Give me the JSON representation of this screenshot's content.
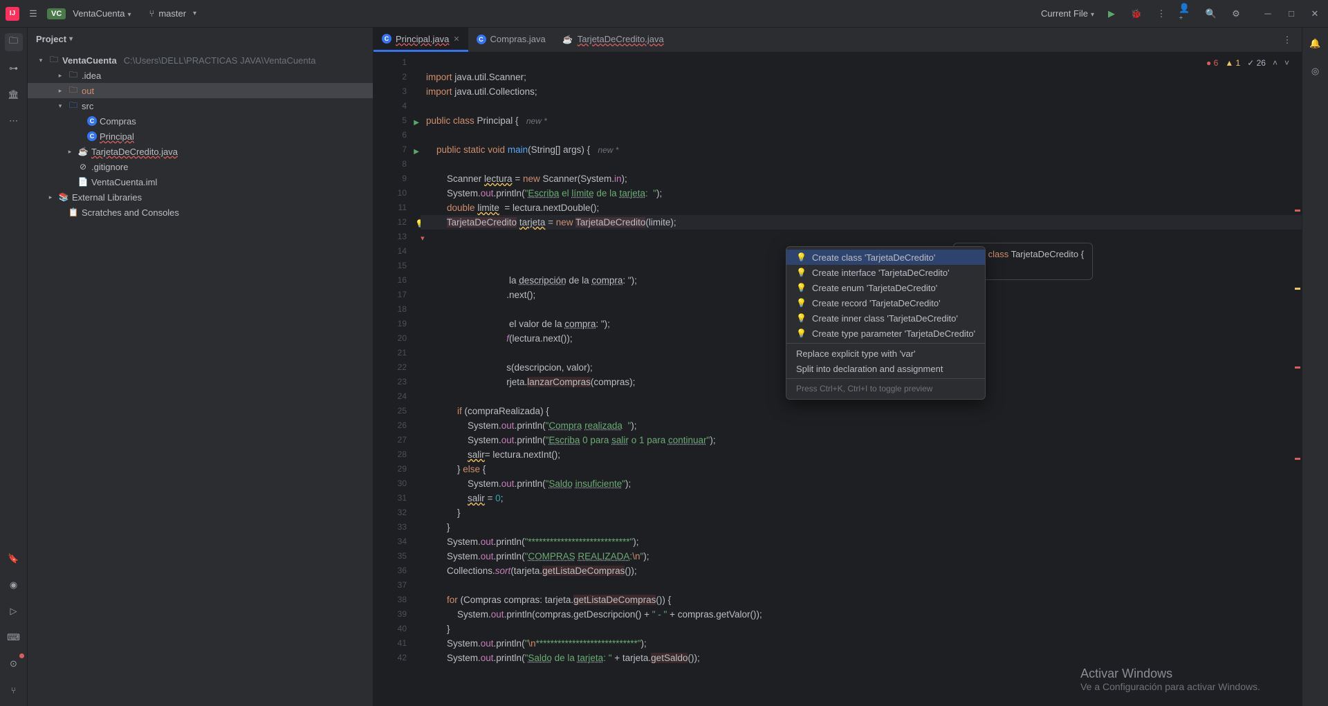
{
  "titlebar": {
    "project_badge": "VC",
    "project_name": "VentaCuenta",
    "branch": "master",
    "run_config": "Current File"
  },
  "project_panel": {
    "header": "Project",
    "root": "VentaCuenta",
    "root_path": "C:\\Users\\DELL\\PRACTICAS JAVA\\VentaCuenta",
    "items": [
      ".idea",
      "out",
      "src",
      "Compras",
      "Principal",
      "TarjetaDeCredito.java",
      ".gitignore",
      "VentaCuenta.iml",
      "External Libraries",
      "Scratches and Consoles"
    ]
  },
  "tabs": [
    {
      "label": "Principal.java",
      "active": true,
      "error": true
    },
    {
      "label": "Compras.java",
      "active": false,
      "error": false
    },
    {
      "label": "TarjetaDeCredito.java",
      "active": false,
      "error": true
    }
  ],
  "inspections": {
    "errors": "6",
    "warnings": "1",
    "weak": "26"
  },
  "popup": {
    "items": [
      "Create class 'TarjetaDeCredito'",
      "Create interface 'TarjetaDeCredito'",
      "Create enum 'TarjetaDeCredito'",
      "Create record 'TarjetaDeCredito'",
      "Create inner class 'TarjetaDeCredito'",
      "Create type parameter 'TarjetaDeCredito'"
    ],
    "plain_items": [
      "Replace explicit type with 'var'",
      "Split into declaration and assignment"
    ],
    "hint": "Press Ctrl+K, Ctrl+I to toggle preview"
  },
  "preview": {
    "line1": "public class TarjetaDeCredito {",
    "line2": "}"
  },
  "code": {
    "lines": [
      {
        "n": 1,
        "html": ""
      },
      {
        "n": 2,
        "html": "<span class='kw'>import</span> java.util.Scanner;"
      },
      {
        "n": 3,
        "html": "<span class='kw'>import</span> java.util.Collections;"
      },
      {
        "n": 4,
        "html": ""
      },
      {
        "n": 5,
        "run": true,
        "html": "<span class='kw'>public class</span> Principal {   <span class='hint'>new *</span>"
      },
      {
        "n": 6,
        "html": ""
      },
      {
        "n": 7,
        "run": true,
        "html": "    <span class='kw'>public static void</span> <span class='fn'>main</span>(String[] args) {   <span class='hint'>new *</span>"
      },
      {
        "n": 8,
        "html": ""
      },
      {
        "n": 9,
        "html": "        Scanner <span class='warn-underline'>lectura</span> = <span class='kw'>new</span> Scanner(System.<span class='field'>in</span>);"
      },
      {
        "n": 10,
        "html": "        System.<span class='field'>out</span>.println(<span class='str'>\"<span class='typo'>Escriba</span> el <span class='typo'>límite</span> de la <span class='typo'>tarjeta</span>:  \"</span>);"
      },
      {
        "n": 11,
        "html": "        <span class='kw'>double</span> <span class='warn-underline'>limite</span>  = lectura.nextDouble();"
      },
      {
        "n": 12,
        "err": true,
        "current": true,
        "html": "        <span class='err-underline'>TarjetaDeCredito</span> <span class='warn-underline'>tarjeta</span> = <span class='kw'>new</span> <span class='err-underline'>TarjetaDeCredito</span>(limite);"
      },
      {
        "n": 13,
        "html": ""
      },
      {
        "n": 14,
        "html": ""
      },
      {
        "n": 15,
        "html": ""
      },
      {
        "n": 16,
        "html": "                                la <span class='typo'>descripción</span> de la <span class='typo'>compra</span>: \"</span>);"
      },
      {
        "n": 17,
        "html": "                               .next();"
      },
      {
        "n": 18,
        "html": ""
      },
      {
        "n": 19,
        "html": "                                el valor de la <span class='typo'>compra</span>: \"</span>);"
      },
      {
        "n": 20,
        "html": "                               <span class='fn2'>f</span>(lectura.next());"
      },
      {
        "n": 21,
        "html": ""
      },
      {
        "n": 22,
        "html": "                               s(descripcion, valor);"
      },
      {
        "n": 23,
        "html": "                               rjeta.<span class='err-underline'>lanzarCompras</span>(compras);"
      },
      {
        "n": 24,
        "html": ""
      },
      {
        "n": 25,
        "html": "            <span class='kw'>if</span> (compraRealizada) {"
      },
      {
        "n": 26,
        "html": "                System.<span class='field'>out</span>.println(<span class='str'>\"<span class='typo'>Compra</span> <span class='typo'>realizada</span>  \"</span>);"
      },
      {
        "n": 27,
        "html": "                System.<span class='field'>out</span>.println(<span class='str'>\"<span class='typo'>Escriba</span> 0 para <span class='typo'>salir</span> o 1 para <span class='typo'>continuar</span>\"</span>);"
      },
      {
        "n": 28,
        "html": "                <span class='warn-underline'>salir</span>= lectura.nextInt();"
      },
      {
        "n": 29,
        "html": "            } <span class='kw'>else</span> {"
      },
      {
        "n": 30,
        "html": "                System.<span class='field'>out</span>.println(<span class='str'>\"<span class='typo'>Saldo</span> <span class='typo'>insuficiente</span>\"</span>);"
      },
      {
        "n": 31,
        "html": "                <span class='warn-underline'>salir</span> = <span class='num'>0</span>;"
      },
      {
        "n": 32,
        "html": "            }"
      },
      {
        "n": 33,
        "html": "        }"
      },
      {
        "n": 34,
        "html": "        System.<span class='field'>out</span>.println(<span class='str'>\"****************************\"</span>);"
      },
      {
        "n": 35,
        "html": "        System.<span class='field'>out</span>.println(<span class='str'>\"<span class='typo'>COMPRAS</span> <span class='typo'>REALIZADA</span>:<span class='kw'>\\n</span>\"</span>);"
      },
      {
        "n": 36,
        "html": "        Collections.<span class='fn2'>sort</span>(tarjeta.<span class='err-underline'>getListaDeCompras</span>());"
      },
      {
        "n": 37,
        "html": ""
      },
      {
        "n": 38,
        "html": "        <span class='kw'>for</span> (Compras compras: tarjeta.<span class='err-underline'>getListaDeCompras</span>()) {"
      },
      {
        "n": 39,
        "html": "            System.<span class='field'>out</span>.println(compras.getDescripcion() + <span class='str'>\" - \"</span> + compras.getValor());"
      },
      {
        "n": 40,
        "html": "        }"
      },
      {
        "n": 41,
        "html": "        System.<span class='field'>out</span>.println(<span class='str'>\"<span class='kw'>\\n</span>****************************\"</span>);"
      },
      {
        "n": 42,
        "html": "        System.<span class='field'>out</span>.println(<span class='str'>\"<span class='typo'>Saldo</span> de la <span class='typo'>tarjeta</span>: \"</span> + tarjeta.<span class='err-underline'>getSaldo</span>());"
      }
    ]
  },
  "watermark": {
    "title": "Activar Windows",
    "sub": "Ve a Configuración para activar Windows."
  }
}
